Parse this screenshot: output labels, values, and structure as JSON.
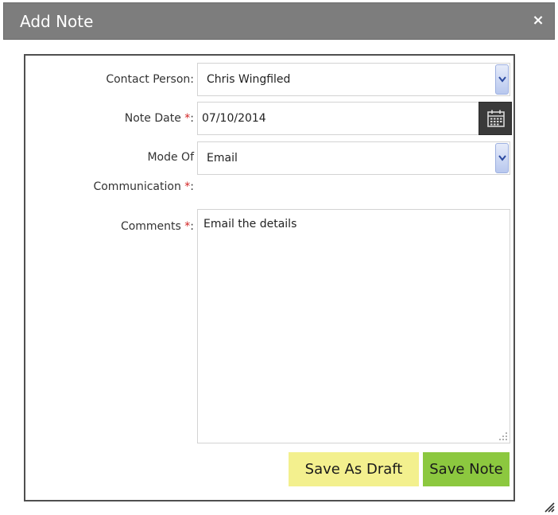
{
  "dialog": {
    "title": "Add Note",
    "close_glyph": "×"
  },
  "form": {
    "contact_person": {
      "label": "Contact Person:",
      "value": "Chris Wingfiled"
    },
    "note_date": {
      "label": "Note Date",
      "required_mark": "*",
      "colon": ":",
      "value": "07/10/2014",
      "picker_icon": "calendar-icon"
    },
    "mode": {
      "label_line1": "Mode Of",
      "label_line2": "Communication",
      "required_mark": "*",
      "colon": ":",
      "value": "Email"
    },
    "comments": {
      "label": "Comments",
      "required_mark": "*",
      "colon": ":",
      "value": "Email the details"
    }
  },
  "actions": {
    "save_draft_label": "Save As Draft",
    "save_note_label": "Save Note"
  },
  "colors": {
    "titlebar": "#7d7d7d",
    "required": "#d22222",
    "draft_button": "#f3f08e",
    "save_button": "#8cc83f",
    "calendar_button": "#3a3a3a"
  }
}
